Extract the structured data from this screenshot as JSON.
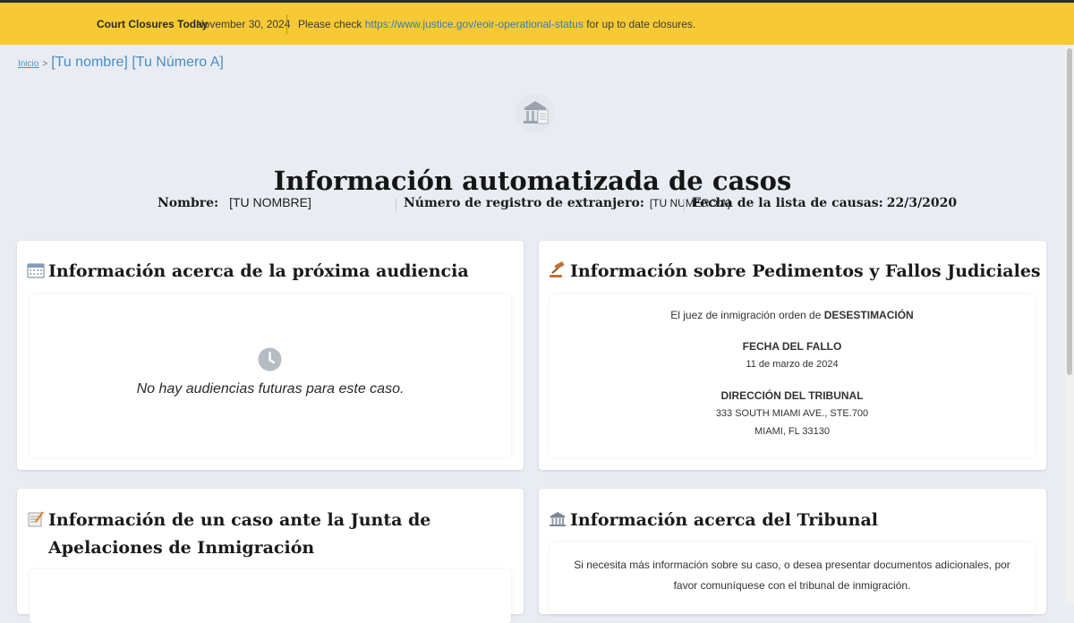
{
  "alert": {
    "title": "Court Closures Today",
    "date": "November 30, 2024",
    "message_prefix": "Please check",
    "link_text": "https://www.justice.gov/eoir-operational-status",
    "message_suffix": "for up to date closures."
  },
  "breadcrumb": {
    "home": "Inicio",
    "separator": ">",
    "current": "[Tu nombre] [Tu Número A]"
  },
  "page": {
    "title": "Información automatizada de casos",
    "name_label": "Nombre:",
    "name_value": "[TU NOMBRE]",
    "registration_label": "Número de registro de extranjero:",
    "registration_value": "[TU NUMERO A]",
    "docket_label": "Fecha de la lista de causas:",
    "docket_value": "22/3/2020"
  },
  "hearing_card": {
    "title": "Información acerca de la próxima audiencia",
    "icon": "calendar-icon",
    "empty_icon": "clock-icon",
    "empty_text": "No hay audiencias futuras para este caso."
  },
  "motions_card": {
    "title": "Información sobre Pedimentos y Fallos Judiciales",
    "icon": "gavel-icon",
    "decision_prefix": "El juez de inmigración orden de",
    "decision_value": "DESESTIMACIÓN",
    "ruling_date_label": "FECHA DEL FALLO",
    "ruling_date_value": "11 de marzo de 2024",
    "court_address_label": "DIRECCIÓN DEL TRIBUNAL",
    "court_address_line1": "333 SOUTH MIAMI AVE., STE.700",
    "court_address_line2": "MIAMI, FL 33130"
  },
  "appeals_card": {
    "title": "Información de un caso ante la Junta de Apelaciones de Inmigración",
    "icon": "memo-icon"
  },
  "court_card": {
    "title": "Información acerca del Tribunal",
    "icon": "courthouse-icon",
    "text": "Si necesita más información sobre su caso, o desea presentar documentos adicionales, por favor comuníquese con el tribunal de inmigración."
  },
  "colors": {
    "alert_bg": "#f6c935",
    "page_bg": "#e9edf3",
    "link": "#2f7fb8"
  }
}
